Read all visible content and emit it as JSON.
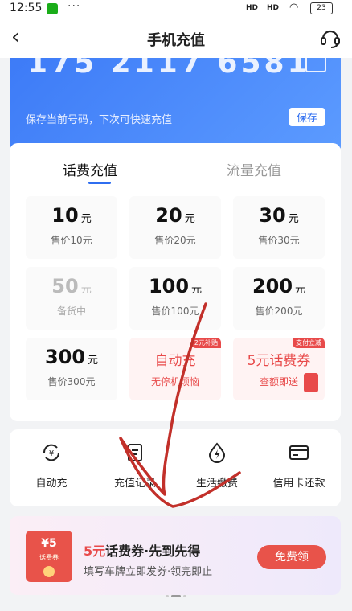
{
  "status_bar": {
    "time": "12:55",
    "dots": "···",
    "signal1": "HD",
    "signal2": "HD",
    "battery": "23"
  },
  "nav": {
    "title": "手机充值"
  },
  "account": {
    "phone_partial": "175 2117 6581",
    "save_tip": "保存当前号码，下次可快速充值",
    "save_label": "保存"
  },
  "tabs": [
    {
      "label": "话费充值"
    },
    {
      "label": "流量充值"
    }
  ],
  "amounts": [
    {
      "amount": "10",
      "unit": "元",
      "price": "售价10元"
    },
    {
      "amount": "20",
      "unit": "元",
      "price": "售价20元"
    },
    {
      "amount": "30",
      "unit": "元",
      "price": "售价30元"
    },
    {
      "amount": "50",
      "unit": "元",
      "price": "备货中"
    },
    {
      "amount": "100",
      "unit": "元",
      "price": "售价100元"
    },
    {
      "amount": "200",
      "unit": "元",
      "price": "售价200元"
    },
    {
      "amount": "300",
      "unit": "元",
      "price": "售价300元"
    }
  ],
  "promos": [
    {
      "title": "自动充",
      "subtitle": "无停机烦恼",
      "tag": "2元补贴"
    },
    {
      "title": "5元话费券",
      "subtitle": "查额即送",
      "tag": "支付立减"
    }
  ],
  "services": [
    {
      "label": "自动充",
      "icon": "yen-cycle-icon"
    },
    {
      "label": "充值记录",
      "icon": "record-icon"
    },
    {
      "label": "生活缴费",
      "icon": "lightning-icon"
    },
    {
      "label": "信用卡还款",
      "icon": "credit-card-icon"
    }
  ],
  "banner": {
    "ticket_value": "¥5",
    "ticket_text": "话费券",
    "title_red": "5元",
    "title_rest": "话费券·先到先得",
    "subtitle": "填写车牌立即发券·领完即止",
    "button": "免费领"
  },
  "colors": {
    "accent": "#2f6ef0",
    "promo_red": "#e84a4a",
    "scribble": "#c2302a"
  }
}
